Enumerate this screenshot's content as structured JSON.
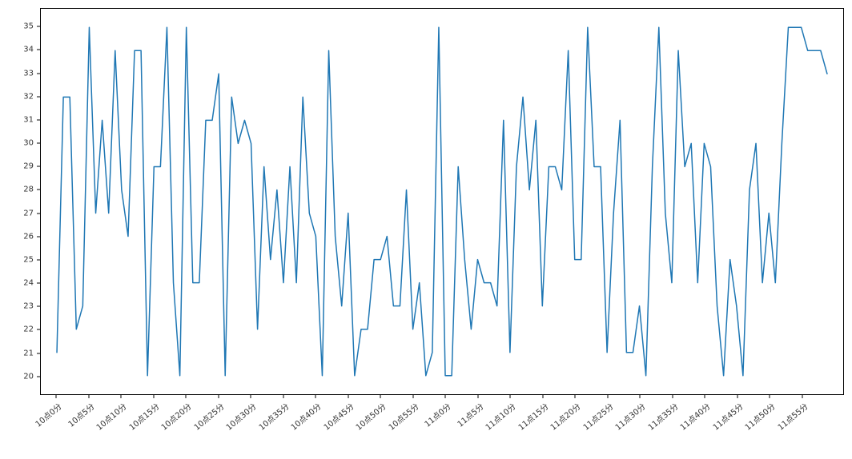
{
  "chart_data": {
    "type": "line",
    "title": "",
    "xlabel": "",
    "ylabel": "",
    "ylim": [
      19.2,
      35.8
    ],
    "y_ticks": [
      20,
      21,
      22,
      23,
      24,
      25,
      26,
      27,
      28,
      29,
      30,
      31,
      32,
      33,
      34,
      35
    ],
    "x_tick_step": 5,
    "x_tick_labels": [
      "10点0分",
      "10点5分",
      "10点10分",
      "10点15分",
      "10点20分",
      "10点25分",
      "10点30分",
      "10点35分",
      "10点40分",
      "10点45分",
      "10点50分",
      "10点55分",
      "11点0分",
      "11点5分",
      "11点10分",
      "11点15分",
      "11点20分",
      "11点25分",
      "11点30分",
      "11点35分",
      "11点40分",
      "11点45分",
      "11点50分",
      "11点55分"
    ],
    "categories_note": "x is minute index 0..119 (tick labels every 5)",
    "values": [
      21,
      32,
      32,
      22,
      23,
      35,
      27,
      31,
      27,
      34,
      28,
      26,
      34,
      34,
      20,
      29,
      29,
      35,
      24,
      20,
      35,
      24,
      24,
      31,
      31,
      33,
      20,
      32,
      30,
      31,
      30,
      22,
      29,
      25,
      28,
      24,
      29,
      24,
      32,
      27,
      26,
      20,
      34,
      26,
      23,
      27,
      20,
      22,
      22,
      25,
      25,
      26,
      23,
      23,
      28,
      22,
      24,
      20,
      21,
      35,
      20,
      20,
      29,
      25,
      22,
      25,
      24,
      24,
      23,
      31,
      21,
      29,
      32,
      28,
      31,
      23,
      29,
      29,
      28,
      34,
      25,
      25,
      35,
      29,
      29,
      21,
      27,
      31,
      21,
      21,
      23,
      20,
      29,
      35,
      27,
      24,
      34,
      29,
      30,
      24,
      30,
      29,
      23,
      20,
      25,
      23,
      20,
      28,
      30,
      24,
      27,
      24,
      30,
      35,
      35,
      35,
      34,
      34,
      34,
      33
    ],
    "line_color": "#1f77b4"
  }
}
